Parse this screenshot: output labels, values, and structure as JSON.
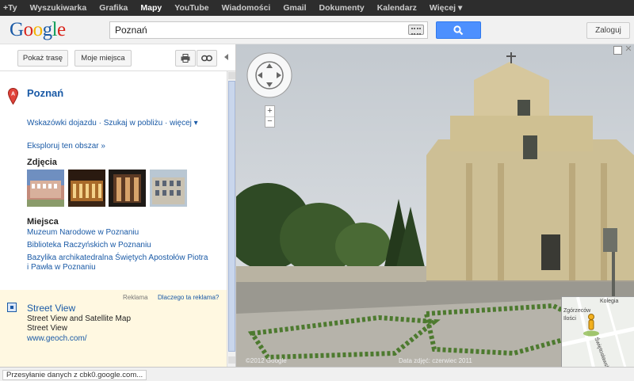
{
  "topbar": {
    "items": [
      {
        "label": "+Ty",
        "active": false
      },
      {
        "label": "Wyszukiwarka",
        "active": false
      },
      {
        "label": "Grafika",
        "active": false
      },
      {
        "label": "Mapy",
        "active": true
      },
      {
        "label": "YouTube",
        "active": false
      },
      {
        "label": "Wiadomości",
        "active": false
      },
      {
        "label": "Gmail",
        "active": false
      },
      {
        "label": "Dokumenty",
        "active": false
      },
      {
        "label": "Kalendarz",
        "active": false
      },
      {
        "label": "Więcej ▾",
        "active": false
      }
    ]
  },
  "header": {
    "logo_letters": [
      "G",
      "o",
      "o",
      "g",
      "l",
      "e"
    ],
    "logo_colors": [
      "#1a5aa6",
      "#d9251c",
      "#f4b400",
      "#1a5aa6",
      "#109d58",
      "#d9251c"
    ],
    "search_value": "Poznań",
    "search_icon": "search-icon",
    "keyboard_icon": "keyboard-icon",
    "login_label": "Zaloguj"
  },
  "toolbar": {
    "directions_label": "Pokaż trasę",
    "my_places_label": "Moje miejsca",
    "print_icon": "print-icon",
    "link_icon": "link-icon"
  },
  "place": {
    "title": "Poznań",
    "links": "Wskazówki dojazdu · Szukaj w pobliżu · więcej ▾",
    "explore": "Eksploruj ten obszar »",
    "photos_heading": "Zdjęcia",
    "places_heading": "Miejsca",
    "places": [
      "Muzeum Narodowe w Poznaniu",
      "Biblioteka Raczyńskich w Poznaniu",
      "Bazylika archikatedralna Świętych Apostołów Piotra",
      "i Pawła w Poznaniu"
    ]
  },
  "ad": {
    "label": "Reklama",
    "why": "Dlaczego ta reklama?",
    "title": "Street View",
    "line1": "Street View and Satellite Map",
    "line2": "Street View",
    "url": "www.geoch.com/"
  },
  "streetview": {
    "copyright": "©2012 Google",
    "copyright_right": "Data zdjęć: czerwiec 2011",
    "minimap_labels": [
      "Kolegia",
      "Zgórzeców",
      "Ilości",
      "Świętosławska"
    ]
  },
  "status": {
    "text": "Przesyłanie danych z cbk0.google.com..."
  },
  "colors": {
    "accent": "#4d90fe",
    "link": "#1a5aa6",
    "topbar": "#2d2d2d"
  }
}
